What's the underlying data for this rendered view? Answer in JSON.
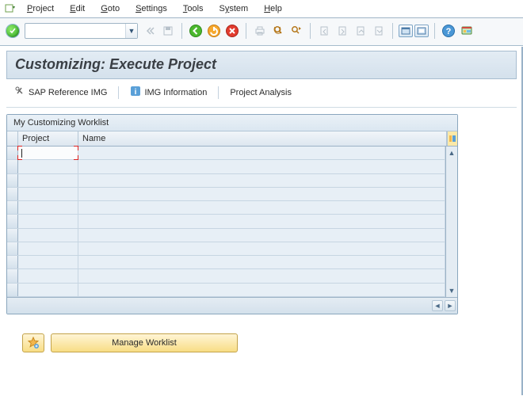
{
  "menu": {
    "items": [
      {
        "raw": "Project",
        "pre": "",
        "ul": "P",
        "post": "roject"
      },
      {
        "raw": "Edit",
        "pre": "",
        "ul": "E",
        "post": "dit"
      },
      {
        "raw": "Goto",
        "pre": "",
        "ul": "G",
        "post": "oto"
      },
      {
        "raw": "Settings",
        "pre": "",
        "ul": "S",
        "post": "ettings"
      },
      {
        "raw": "Tools",
        "pre": "",
        "ul": "T",
        "post": "ools"
      },
      {
        "raw": "System",
        "pre": "S",
        "ul": "y",
        "post": "stem"
      },
      {
        "raw": "Help",
        "pre": "",
        "ul": "H",
        "post": "elp"
      }
    ]
  },
  "toolbar": {
    "command_value": "",
    "icons": {
      "status": "ok-status-icon",
      "expand": "expand-icon",
      "save": "save-icon",
      "back": "back-icon",
      "exit": "exit-icon",
      "cancel": "cancel-icon",
      "print": "print-icon",
      "find": "find-icon",
      "find_next": "find-next-icon",
      "first": "first-page-icon",
      "prev": "prev-page-icon",
      "next": "next-page-icon",
      "last": "last-page-icon",
      "new_session": "new-session-icon",
      "layout": "layout-icon",
      "help": "help-icon",
      "customize": "customize-local-layout-icon"
    }
  },
  "page": {
    "title": "Customizing: Execute Project"
  },
  "appbar": {
    "sap_ref_img": "SAP Reference IMG",
    "img_info": "IMG Information",
    "project_analysis": "Project Analysis"
  },
  "worklist": {
    "panel_title": "My Customizing Worklist",
    "columns": {
      "project": "Project",
      "name": "Name"
    },
    "rows": [
      {
        "project": "",
        "name": ""
      }
    ],
    "empty_rows": 10
  },
  "buttons": {
    "manage_worklist": "Manage Worklist",
    "favorite": "add-favorite-icon"
  },
  "colors": {
    "accent_blue": "#7ba3c5",
    "gold": "#f8dd85",
    "green": "#29a81f",
    "orange": "#f39a2b",
    "red": "#d23a2e",
    "highlight": "#d22"
  }
}
